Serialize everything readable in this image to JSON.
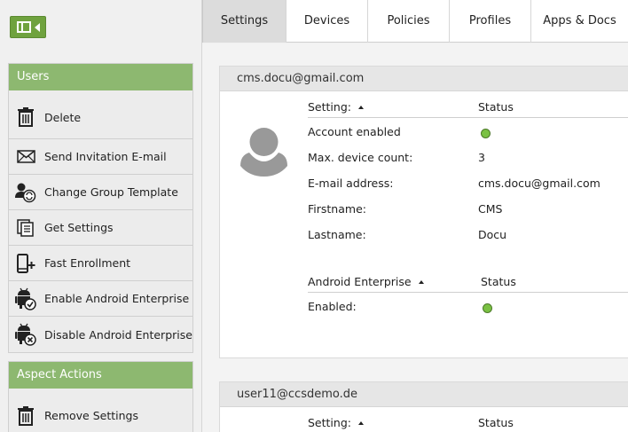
{
  "sidebar": {
    "users_header": "Users",
    "users_items": [
      {
        "label": "Delete",
        "icon": "trash-icon"
      },
      {
        "label": "Send Invitation E-mail",
        "icon": "envelope-icon"
      },
      {
        "label": "Change Group Template",
        "icon": "group-template-icon"
      },
      {
        "label": "Get Settings",
        "icon": "settings-list-icon"
      },
      {
        "label": "Fast Enrollment",
        "icon": "phone-plus-icon"
      },
      {
        "label": "Enable Android Enterprise",
        "icon": "android-check-icon"
      },
      {
        "label": "Disable Android Enterprise",
        "icon": "android-x-icon"
      }
    ],
    "aspect_header": "Aspect Actions",
    "aspect_items": [
      {
        "label": "Remove Settings",
        "icon": "trash-icon"
      }
    ]
  },
  "tabs": [
    {
      "label": "Settings",
      "active": true
    },
    {
      "label": "Devices",
      "active": false
    },
    {
      "label": "Policies",
      "active": false
    },
    {
      "label": "Profiles",
      "active": false
    },
    {
      "label": "Apps & Docs",
      "active": false
    }
  ],
  "users": [
    {
      "email": "cms.docu@gmail.com",
      "settings_header": {
        "setting": "Setting:",
        "status": "Status"
      },
      "settings": [
        {
          "key": "Account enabled",
          "value": "",
          "status_dot": true
        },
        {
          "key": "Max. device count:",
          "value": "3"
        },
        {
          "key": "E-mail address:",
          "value": "cms.docu@gmail.com"
        },
        {
          "key": "Firstname:",
          "value": "CMS"
        },
        {
          "key": "Lastname:",
          "value": "Docu"
        }
      ],
      "enterprise_header": {
        "setting": "Android Enterprise",
        "status": "Status"
      },
      "enterprise": [
        {
          "key": "Enabled:",
          "value": "",
          "status_dot": true
        }
      ]
    },
    {
      "email": "user11@ccsdemo.de",
      "settings_header": {
        "setting": "Setting:",
        "status": "Status"
      }
    }
  ],
  "colors": {
    "accent_green": "#8db870",
    "toggle_green": "#6fa23e",
    "status_green": "#7ac143"
  }
}
